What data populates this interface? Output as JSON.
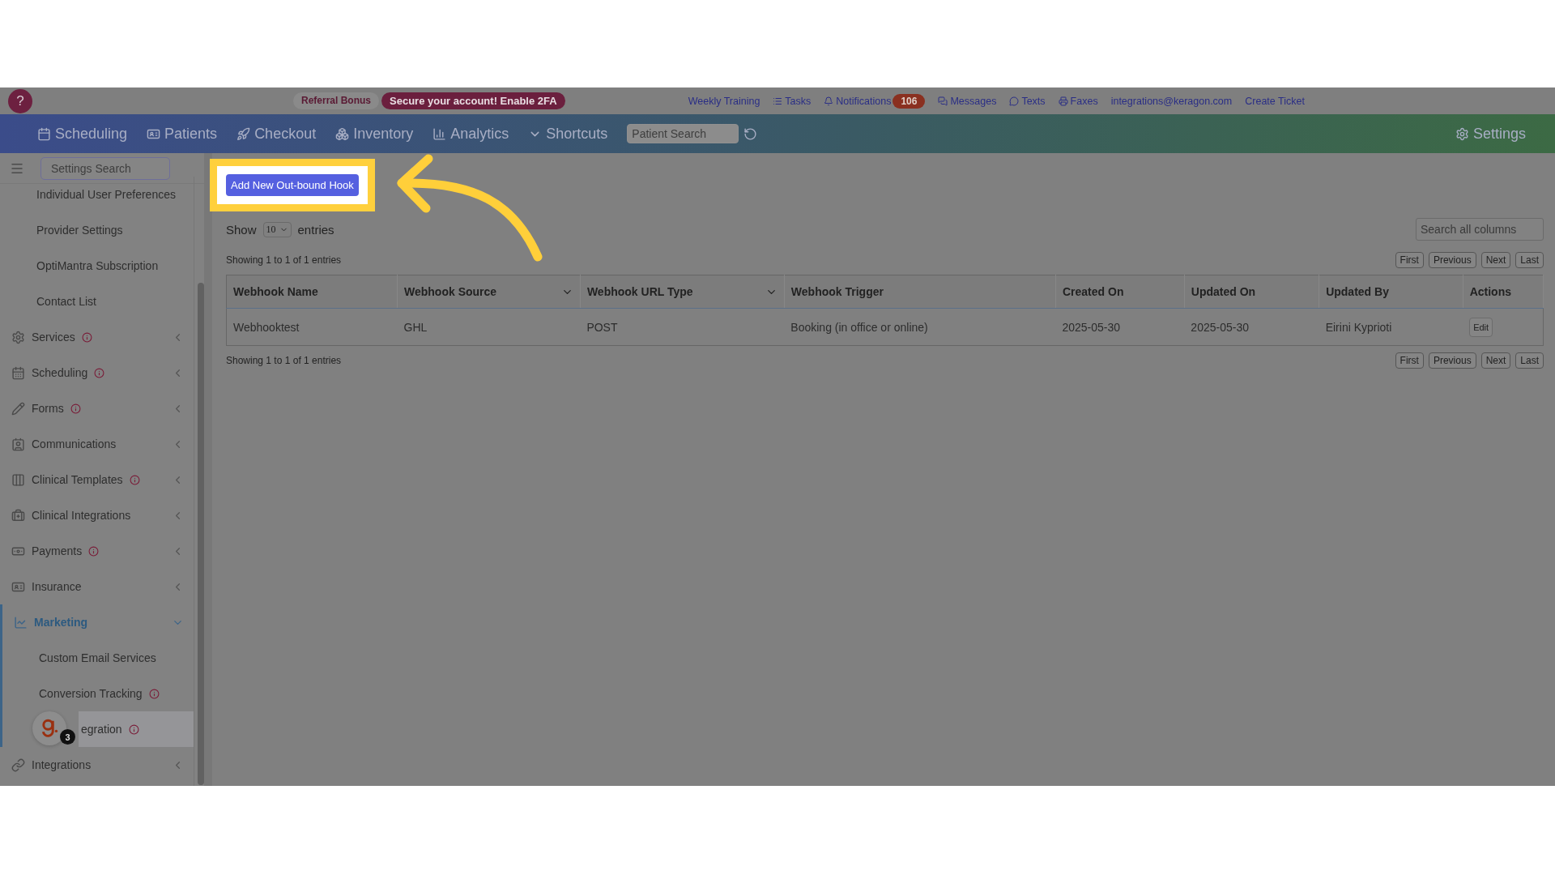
{
  "top_bar": {
    "help": "?",
    "referral": "Referral Bonus",
    "security": "Secure your account! Enable 2FA",
    "links": [
      {
        "label": "Weekly Training"
      },
      {
        "label": "Tasks"
      },
      {
        "label": "Notifications",
        "badge": "106"
      },
      {
        "label": "Messages"
      },
      {
        "label": "Texts"
      },
      {
        "label": "Faxes"
      },
      {
        "label": "integrations@keragon.com"
      },
      {
        "label": "Create Ticket"
      }
    ]
  },
  "nav": {
    "items": [
      {
        "label": "Scheduling"
      },
      {
        "label": "Patients"
      },
      {
        "label": "Checkout"
      },
      {
        "label": "Inventory"
      },
      {
        "label": "Analytics"
      },
      {
        "label": "Shortcuts"
      }
    ],
    "search": {
      "placeholder": "Patient Search"
    },
    "settings": "Settings"
  },
  "sidebar": {
    "search": {
      "placeholder": "Settings Search"
    },
    "items": [
      {
        "kind": "link",
        "label": "Individual User Preferences",
        "alert": false,
        "selected": false
      },
      {
        "kind": "link",
        "label": "Provider Settings",
        "alert": false,
        "selected": false
      },
      {
        "kind": "link",
        "label": "OptiMantra Subscription",
        "alert": false,
        "selected": false
      },
      {
        "kind": "link",
        "label": "Contact List",
        "alert": false,
        "selected": false
      },
      {
        "kind": "group",
        "label": "Services",
        "alert": true,
        "expanded": false,
        "selected": false
      },
      {
        "kind": "group",
        "label": "Scheduling",
        "alert": true,
        "expanded": false,
        "selected": false
      },
      {
        "kind": "group",
        "label": "Forms",
        "alert": true,
        "expanded": false,
        "selected": false
      },
      {
        "kind": "group",
        "label": "Communications",
        "alert": false,
        "expanded": false,
        "selected": false
      },
      {
        "kind": "group",
        "label": "Clinical Templates",
        "alert": true,
        "expanded": false,
        "selected": false
      },
      {
        "kind": "group",
        "label": "Clinical Integrations",
        "alert": false,
        "expanded": false,
        "selected": false
      },
      {
        "kind": "group",
        "label": "Payments",
        "alert": true,
        "expanded": false,
        "selected": false
      },
      {
        "kind": "group",
        "label": "Insurance",
        "alert": false,
        "expanded": false,
        "selected": false
      },
      {
        "kind": "group",
        "label": "Marketing",
        "alert": false,
        "expanded": true,
        "selected": true,
        "children": [
          {
            "kind": "link",
            "label": "Custom Email Services",
            "alert": false,
            "selected": false
          },
          {
            "kind": "link",
            "label": "Conversion Tracking",
            "alert": true,
            "selected": false
          },
          {
            "kind": "link",
            "label": "egration",
            "alert": true,
            "selected": true
          }
        ]
      },
      {
        "kind": "group",
        "label": "Integrations",
        "alert": false,
        "expanded": false,
        "selected": false
      }
    ]
  },
  "content": {
    "add_button": "Add New Out-bound Hook",
    "length": {
      "before": "Show",
      "value": "10",
      "after": "entries"
    },
    "search": {
      "placeholder": "Search all columns"
    },
    "info_top": "Showing 1 to 1 of 1 entries",
    "info_bottom": "Showing 1 to 1 of 1 entries",
    "pager_top": [
      "First",
      "Previous",
      "Next",
      "Last"
    ],
    "pager_bottom": [
      "First",
      "Previous",
      "Next",
      "Last"
    ],
    "table": {
      "columns": [
        {
          "label": "Webhook Name",
          "filter": false
        },
        {
          "label": "Webhook Source",
          "filter": true
        },
        {
          "label": "Webhook URL Type",
          "filter": true
        },
        {
          "label": "Webhook Trigger",
          "filter": false
        },
        {
          "label": "Created On",
          "filter": false
        },
        {
          "label": "Updated On",
          "filter": false
        },
        {
          "label": "Updated By",
          "filter": false
        },
        {
          "label": "Actions",
          "filter": false
        }
      ],
      "rows": [
        {
          "cells": [
            "Webhooktest",
            "GHL",
            "POST",
            "Booking (in office or online)",
            "2025-05-30",
            "2025-05-30",
            "Eirini Kyprioti"
          ],
          "action": "Edit"
        }
      ]
    }
  },
  "tutorial": {
    "step": "3"
  }
}
